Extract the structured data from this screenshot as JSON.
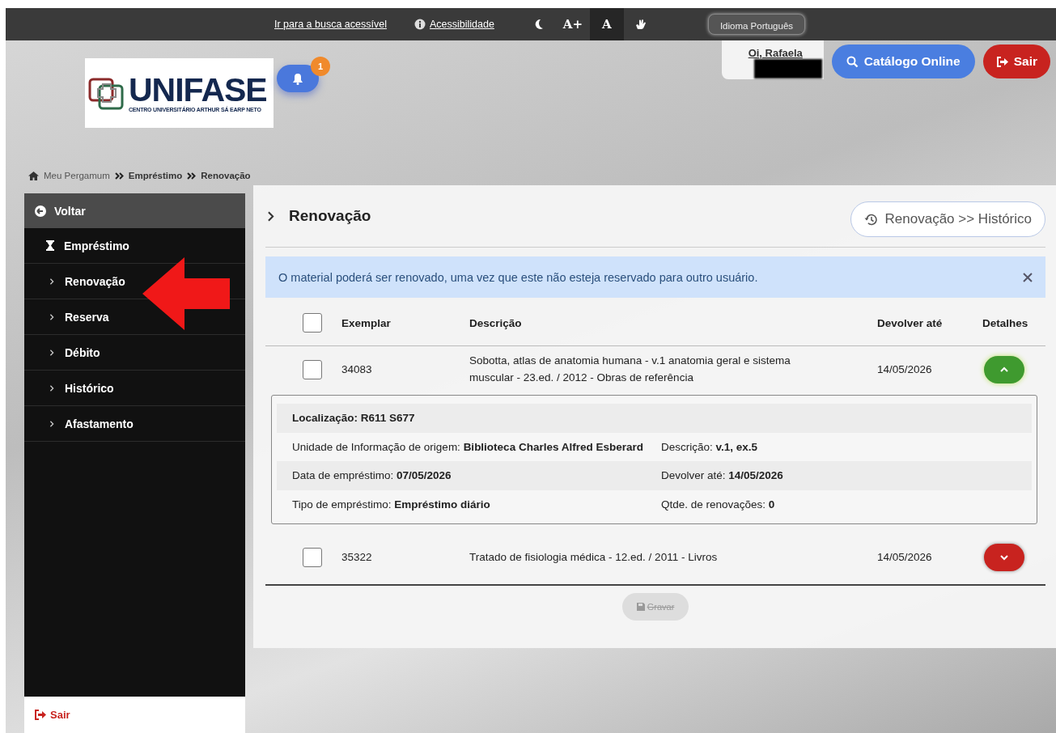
{
  "top_bar": {
    "links": [
      {
        "kind": "plain",
        "label": "Ir para a busca acessível"
      },
      {
        "kind": "info",
        "label": "Acessibilidade"
      }
    ],
    "font_buttons": [
      {
        "label": "A+",
        "selected": false
      },
      {
        "label": "A",
        "selected": true
      }
    ],
    "language_button": "Idioma Português"
  },
  "header": {
    "logo": {
      "name": "UNIFASE",
      "subtitle": "CENTRO UNIVERSITÁRIO ARTHUR SÁ EARP NETO"
    },
    "notification_count": "1",
    "greeting": "Oi, Rafaela",
    "catalog_button": "Catálogo Online",
    "logout_button": "Sair"
  },
  "breadcrumb": [
    "Meu Pergamum",
    "Empréstimo",
    "Renovação"
  ],
  "sidebar": {
    "back": "Voltar",
    "items": [
      {
        "kind": "section",
        "label": "Empréstimo"
      },
      {
        "kind": "link",
        "label": "Renovação"
      },
      {
        "kind": "link",
        "label": "Reserva"
      },
      {
        "kind": "link",
        "label": "Débito"
      },
      {
        "kind": "link",
        "label": "Histórico"
      },
      {
        "kind": "link",
        "label": "Afastamento"
      }
    ],
    "logout": "Sair"
  },
  "page": {
    "title": "Renovação",
    "history_button": "Renovação >> Histórico",
    "alert": "O material poderá ser renovado, uma vez que este não esteja reservado para outro usuário.",
    "table": {
      "columns": [
        "Exemplar",
        "Descrição",
        "Devolver até",
        "Detalhes"
      ],
      "header_checked": false,
      "rows": [
        {
          "checked": false,
          "exemplar": "34083",
          "description": "Sobotta, atlas de anatomia humana - v.1 anatomia geral e sistema muscular - 23.ed. / 2012 - Obras de referência",
          "due": "14/05/2026",
          "expanded": true,
          "details": [
            {
              "kind": "heading",
              "items": [
                "Localização: R611 S677"
              ]
            },
            {
              "kind": "pair",
              "items": [
                "Unidade de Informação de origem: **Biblioteca Charles Alfred Esberard**",
                "Descrição: **v.1, ex.5**"
              ]
            },
            {
              "kind": "pair",
              "items": [
                "Data de empréstimo: **07/05/2026**",
                "Devolver até: **14/05/2026**"
              ]
            },
            {
              "kind": "pair",
              "items": [
                "Tipo de empréstimo: **Empréstimo diário**",
                "Qtde. de renovações: **0**"
              ]
            }
          ]
        },
        {
          "checked": false,
          "exemplar": "35322",
          "description": "Tratado de fisiologia médica - 12.ed. / 2011 - Livros",
          "due": "14/05/2026",
          "expanded": false
        }
      ]
    },
    "save_button": {
      "label": "Gravar",
      "disabled": true
    }
  }
}
